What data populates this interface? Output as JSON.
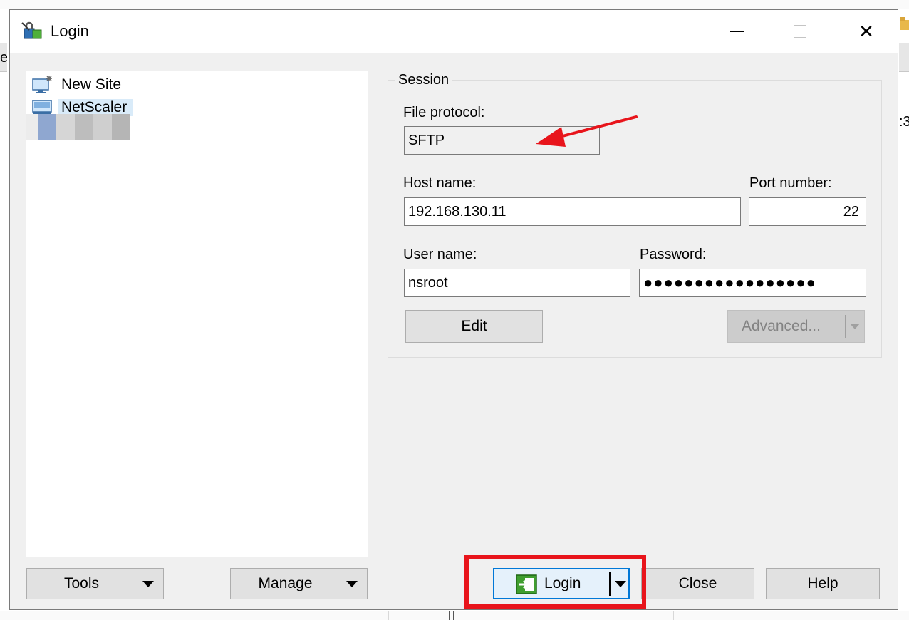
{
  "window": {
    "title": "Login"
  },
  "titlebar_controls": {
    "close_glyph": "✕"
  },
  "background": {
    "left_text": "er",
    "right_text": ":3"
  },
  "tree": {
    "items": [
      {
        "label": "New Site",
        "icon": "new-site-icon"
      },
      {
        "label": "NetScaler",
        "icon": "site-icon",
        "selected": true
      }
    ]
  },
  "session": {
    "legend": "Session",
    "file_protocol_label": "File protocol:",
    "file_protocol_value": "SFTP",
    "host_label": "Host name:",
    "host_value": "192.168.130.11",
    "port_label": "Port number:",
    "port_value": "22",
    "user_label": "User name:",
    "user_value": "nsroot",
    "password_label": "Password:",
    "password_mask": "●●●●●●●●●●●●●●●●●",
    "edit_label": "Edit",
    "advanced_label": "Advanced..."
  },
  "buttons": {
    "tools": "Tools",
    "manage": "Manage",
    "login": "Login",
    "close": "Close",
    "help": "Help"
  },
  "colors": {
    "annotation_red": "#e8141b",
    "focus_blue": "#0078d7",
    "selection": "#d9ebf9"
  }
}
